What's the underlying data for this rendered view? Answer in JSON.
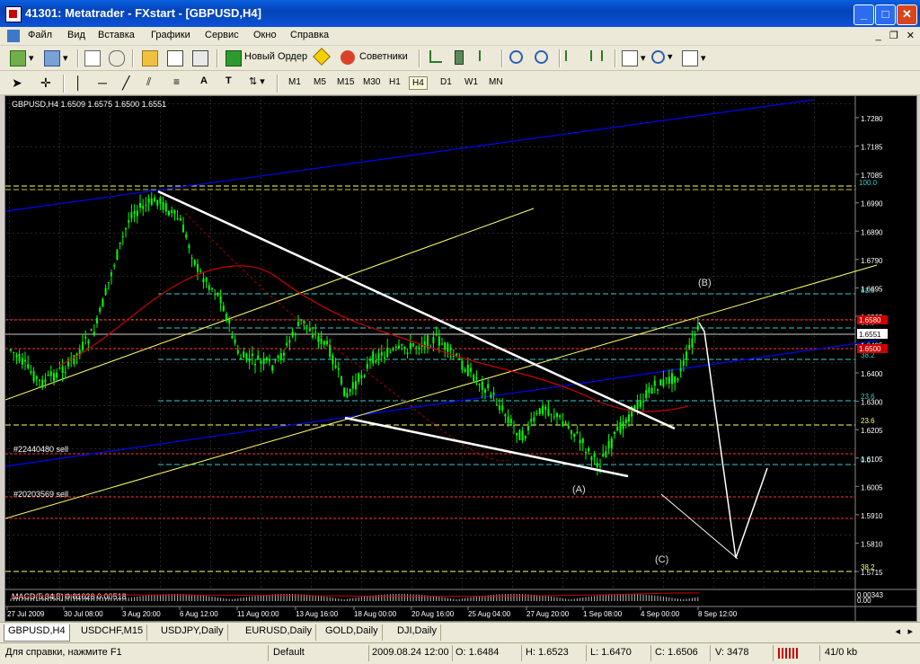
{
  "window": {
    "title": "41301: Metatrader - FXstart - [GBPUSD,H4]"
  },
  "menu": [
    "Файл",
    "Вид",
    "Вставка",
    "Графики",
    "Сервис",
    "Окно",
    "Справка"
  ],
  "toolbar": {
    "new_order": "Новый Ордер",
    "advisors": "Советники"
  },
  "timeframes": [
    "M1",
    "M5",
    "M15",
    "M30",
    "H1",
    "H4",
    "D1",
    "W1",
    "MN"
  ],
  "active_timeframe": "H4",
  "chart": {
    "header": "GBPUSD,H4  1.6509 1.6575 1.6500 1.6551",
    "price_labels": [
      "1.7280",
      "1.7185",
      "1.7085",
      "1.6990",
      "1.6890",
      "1.6790",
      "1.6695",
      "1.6595",
      "1.6495",
      "1.6400",
      "1.6300",
      "1.6205",
      "1.6105",
      "1.6005",
      "1.5910",
      "1.5810",
      "1.5715"
    ],
    "current_price": "1.6551",
    "red_label_1": "1.6580",
    "red_label_2": "1.6500",
    "fib_levels": [
      "100.0",
      "61.8",
      "50.0",
      "38.2",
      "23.6",
      "23.6",
      "0.0",
      "38.2"
    ],
    "wave_labels": [
      "(A)",
      "(B)",
      "(C)"
    ],
    "order_labels": [
      "#22440480 sell",
      "#20203569 sell"
    ],
    "macd_label": "MACD(5,34,5) 0.01026 0.00518",
    "macd_value": "0.00343",
    "macd_zero": "0.00",
    "time_labels": [
      "27 Jul 2009",
      "30 Jul 08:00",
      "3 Aug 20:00",
      "6 Aug 12:00",
      "11 Aug 00:00",
      "13 Aug 16:00",
      "18 Aug 00:00",
      "20 Aug 16:00",
      "25 Aug 04:00",
      "27 Aug 20:00",
      "1 Sep 08:00",
      "4 Sep 00:00",
      "8 Sep 12:00"
    ],
    "colors": {
      "bull": "#00ff00",
      "bear": "#00ff00",
      "trendline_white": "#ffffff",
      "channel_blue": "#0000ff",
      "channel_yellow": "#ffff66",
      "ma_red": "#cc0000"
    }
  },
  "tabs": [
    "GBPUSD,H4",
    "USDCHF,M15",
    "USDJPY,Daily",
    "EURUSD,Daily",
    "GOLD,Daily",
    "DJI,Daily"
  ],
  "status": {
    "help": "Для справки, нажмите F1",
    "profile": "Default",
    "datetime": "2009.08.24 12:00",
    "open": "O: 1.6484",
    "high": "H: 1.6523",
    "low": "L: 1.6470",
    "close": "C: 1.6506",
    "volume": "V: 3478",
    "traffic": "41/0 kb"
  }
}
